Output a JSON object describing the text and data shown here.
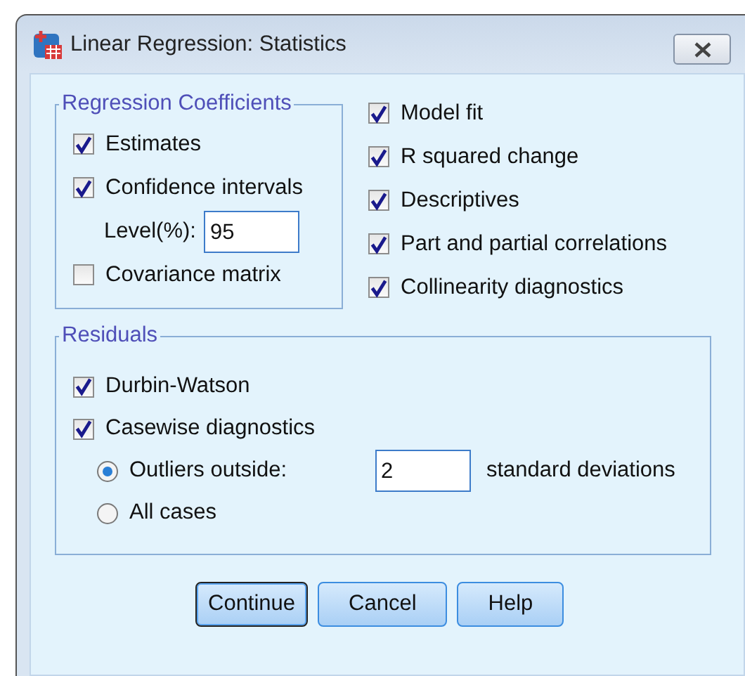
{
  "window": {
    "title": "Linear Regression: Statistics"
  },
  "regression_coefficients": {
    "title": "Regression Coefficients",
    "options": [
      {
        "kind": "checkbox",
        "label": "Estimates",
        "checked": true
      },
      {
        "kind": "checkbox",
        "label": "Confidence intervals",
        "checked": true
      },
      {
        "kind": "field",
        "label": "Level(%):",
        "value": "95"
      },
      {
        "kind": "checkbox",
        "label": "Covariance matrix",
        "checked": false
      }
    ]
  },
  "options": [
    {
      "label": "Model fit",
      "checked": true
    },
    {
      "label": "R squared change",
      "checked": true
    },
    {
      "label": "Descriptives",
      "checked": true
    },
    {
      "label": "Part and partial correlations",
      "checked": true
    },
    {
      "label": "Collinearity diagnostics",
      "checked": true
    }
  ],
  "residuals": {
    "title": "Residuals",
    "options": [
      {
        "kind": "checkbox",
        "label": "Durbin-Watson",
        "checked": true
      },
      {
        "kind": "checkbox",
        "label": "Casewise diagnostics",
        "checked": true
      },
      {
        "kind": "radio",
        "label": "Outliers outside:",
        "selected": true,
        "value": "2",
        "suffix": "standard deviations"
      },
      {
        "kind": "radio",
        "label": "All cases",
        "selected": false
      }
    ]
  },
  "buttons": [
    {
      "label": "Continue",
      "default": true
    },
    {
      "label": "Cancel",
      "default": false
    },
    {
      "label": "Help",
      "default": false
    }
  ]
}
